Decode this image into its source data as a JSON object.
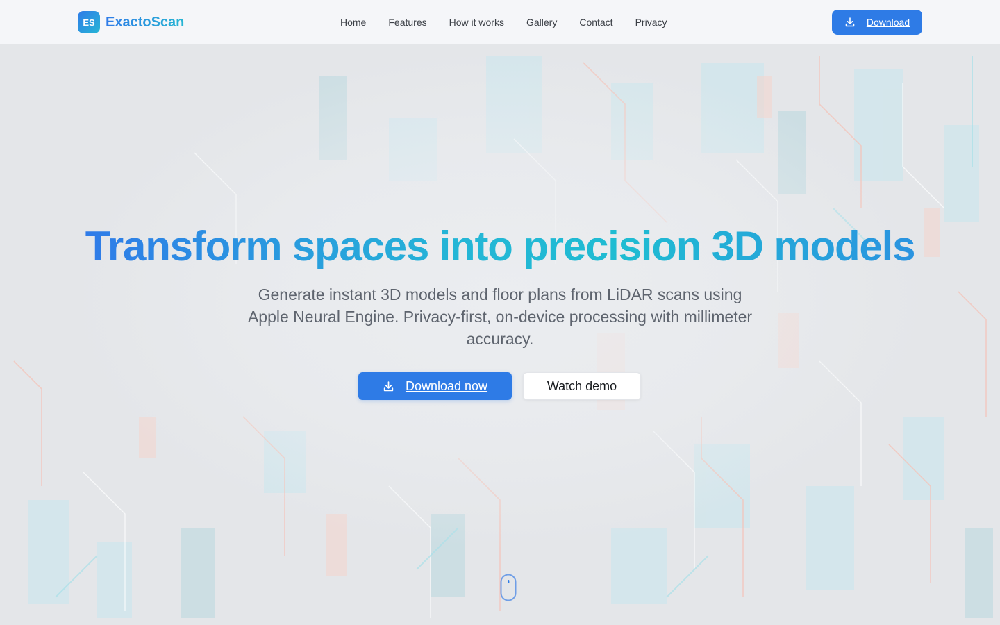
{
  "header": {
    "logo_badge": "ES",
    "logo_text": "ExactoScan",
    "nav": [
      {
        "label": "Home"
      },
      {
        "label": "Features"
      },
      {
        "label": "How it works"
      },
      {
        "label": "Gallery"
      },
      {
        "label": "Contact"
      },
      {
        "label": "Privacy"
      }
    ],
    "download_label": "Download",
    "download_icon": "download-icon"
  },
  "hero": {
    "title": "Transform spaces into precision 3D models",
    "subtitle": "Generate instant 3D models and floor plans from LiDAR scans using Apple Neural Engine. Privacy-first, on-device processing with millimeter accuracy.",
    "primary_cta": "Download now",
    "primary_icon": "download-icon",
    "secondary_cta": "Watch demo",
    "scroll_icon": "mouse-scroll-icon"
  },
  "colors": {
    "accent": "#2e7be6",
    "accent_teal": "#24b6d6",
    "text_muted": "#5e646e",
    "background": "#e4e6e9"
  }
}
